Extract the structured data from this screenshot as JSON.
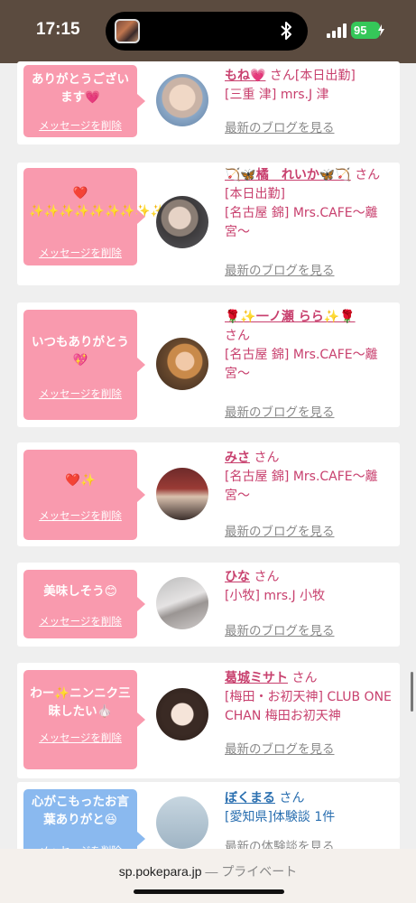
{
  "status_bar": {
    "time": "17:15",
    "battery": "95"
  },
  "browser": {
    "url": "sp.pokepara.jp",
    "separator": " — ",
    "mode": "プライベート"
  },
  "labels": {
    "san": "さん",
    "delete": "メッセージを削除",
    "blog": "最新のブログを見る",
    "blog_alt": "最新の体験談を見る"
  },
  "cards": [
    {
      "message": "ありがとうございます💗",
      "name": "もね💗",
      "status": "[本日出勤]",
      "shop": "[三重 津] mrs.J 津"
    },
    {
      "message": "❤️ ✨✨✨✨✨✨✨✨✨✨",
      "name": "🏹🦋橘　れいか🦋🏹",
      "status": "[本日出勤]",
      "shop": "[名古屋 錦] Mrs.CAFE〜離宮〜"
    },
    {
      "message": "いつもありがとう💖",
      "name": "🌹✨一ノ瀬 らら✨🌹",
      "status": "",
      "shop": "[名古屋 錦] Mrs.CAFE〜離宮〜"
    },
    {
      "message": "❤️✨",
      "name": "みさ",
      "status": "",
      "shop": "[名古屋 錦] Mrs.CAFE〜離宮〜"
    },
    {
      "message": "美味しそう😊",
      "name": "ひな",
      "status": "",
      "shop": "[小牧] mrs.J 小牧"
    },
    {
      "message": "わー✨ニンニク三昧したい🧄",
      "name": "葛城ミサト",
      "status": "",
      "shop": "[梅田・お初天神] CLUB ONE CHAN 梅田お初天神"
    },
    {
      "message": "心がこもったお言葉ありがと😆",
      "name": "ぼくまる",
      "status": "",
      "shop": "[愛知県]体験談 1件"
    }
  ],
  "colors": {
    "accent_pink": "#c8406e",
    "bubble_pink": "#f99aae",
    "bubble_blue": "#8ab9ef",
    "link_blue": "#2a6fb0"
  }
}
